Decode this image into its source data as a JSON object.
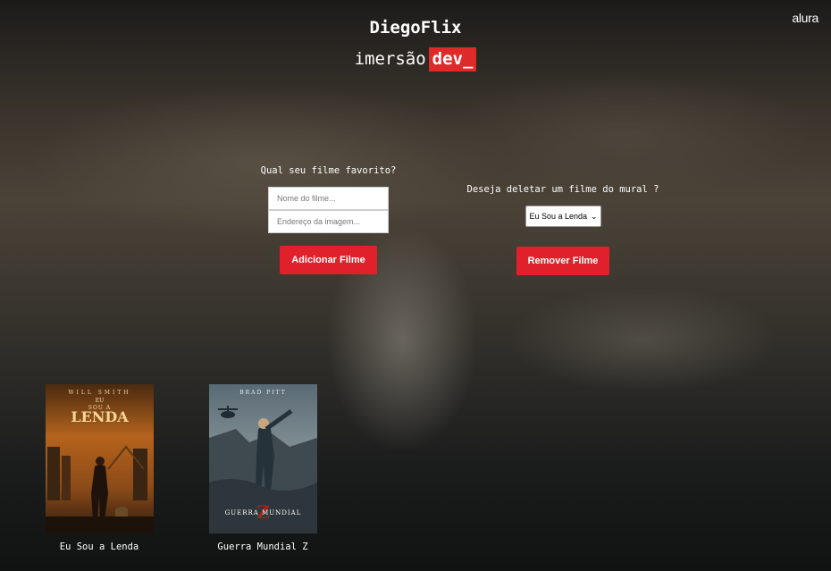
{
  "header": {
    "brand": "alura",
    "title": "DiegoFlix",
    "subtitle_plain": "imersão",
    "subtitle_highlight": "dev_"
  },
  "add_form": {
    "question": "Qual seu filme favorito?",
    "name_placeholder": "Nome do filme...",
    "image_placeholder": "Endereço da imagem...",
    "button_label": "Adicionar Filme"
  },
  "remove_form": {
    "question": "Deseja deletar um filme do mural ?",
    "selected_option": "Eu Sou a Lenda",
    "button_label": "Remover Filme"
  },
  "movies": [
    {
      "title": "Eu Sou a Lenda",
      "poster_texts": {
        "actor": "WILL SMITH",
        "line1": "EU",
        "line2": "SOU A",
        "line3": "LENDA"
      }
    },
    {
      "title": "Guerra Mundial Z",
      "poster_texts": {
        "actor": "BRAD PITT",
        "line1": "GUERRA MUNDIAL",
        "letter": "Z"
      }
    }
  ],
  "colors": {
    "accent_red": "#e0212b",
    "text_white": "#ffffff"
  },
  "icons": {
    "select_chevron": "chevron-down-icon"
  }
}
